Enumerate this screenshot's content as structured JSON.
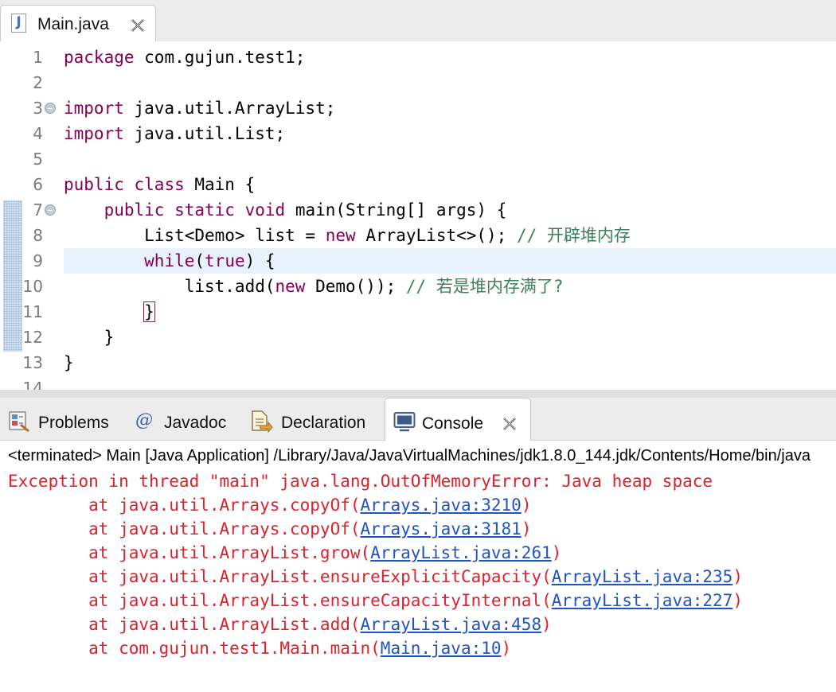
{
  "editor": {
    "tab_label": "Main.java",
    "lines": [
      {
        "num": "1",
        "parts": [
          {
            "t": "package",
            "c": "kw"
          },
          {
            "t": " com.gujun.test1;",
            "c": ""
          }
        ]
      },
      {
        "num": "2",
        "parts": []
      },
      {
        "num": "3",
        "fold": true,
        "parts": [
          {
            "t": "import",
            "c": "kw"
          },
          {
            "t": " java.util.ArrayList;",
            "c": ""
          }
        ]
      },
      {
        "num": "4",
        "parts": [
          {
            "t": "import",
            "c": "kw"
          },
          {
            "t": " java.util.List;",
            "c": ""
          }
        ]
      },
      {
        "num": "5",
        "parts": []
      },
      {
        "num": "6",
        "parts": [
          {
            "t": "public",
            "c": "kw"
          },
          {
            "t": " ",
            "c": ""
          },
          {
            "t": "class",
            "c": "kw"
          },
          {
            "t": " Main {",
            "c": ""
          }
        ]
      },
      {
        "num": "7",
        "fold": true,
        "parts": [
          {
            "t": "    ",
            "c": ""
          },
          {
            "t": "public",
            "c": "kw"
          },
          {
            "t": " ",
            "c": ""
          },
          {
            "t": "static",
            "c": "kw"
          },
          {
            "t": " ",
            "c": ""
          },
          {
            "t": "void",
            "c": "kw"
          },
          {
            "t": " main(String[] args) {",
            "c": ""
          }
        ]
      },
      {
        "num": "8",
        "parts": [
          {
            "t": "        List<Demo> list = ",
            "c": ""
          },
          {
            "t": "new",
            "c": "kw"
          },
          {
            "t": " ArrayList<>(); ",
            "c": ""
          },
          {
            "t": "// 开辟堆内存",
            "c": "cm"
          }
        ]
      },
      {
        "num": "9",
        "current": true,
        "parts": [
          {
            "t": "        ",
            "c": ""
          },
          {
            "t": "while",
            "c": "kw"
          },
          {
            "t": "(",
            "c": ""
          },
          {
            "t": "true",
            "c": "kw"
          },
          {
            "t": ") {",
            "c": ""
          }
        ]
      },
      {
        "num": "10",
        "parts": [
          {
            "t": "            list.add(",
            "c": ""
          },
          {
            "t": "new",
            "c": "kw"
          },
          {
            "t": " Demo()); ",
            "c": ""
          },
          {
            "t": "// 若是堆内存满了?",
            "c": "cm"
          }
        ]
      },
      {
        "num": "11",
        "parts": [
          {
            "t": "        ",
            "c": ""
          },
          {
            "t": "}",
            "c": "brace-box"
          }
        ]
      },
      {
        "num": "12",
        "parts": [
          {
            "t": "    }",
            "c": ""
          }
        ]
      },
      {
        "num": "13",
        "parts": [
          {
            "t": "}",
            "c": ""
          }
        ]
      },
      {
        "num": "14",
        "parts": []
      }
    ]
  },
  "views": {
    "tabs": [
      {
        "label": "Problems",
        "icon": "problems-icon"
      },
      {
        "label": "Javadoc",
        "icon": "javadoc-icon"
      },
      {
        "label": "Declaration",
        "icon": "declaration-icon"
      },
      {
        "label": "Console",
        "icon": "console-icon",
        "active": true
      }
    ]
  },
  "console": {
    "header": "<terminated> Main [Java Application] /Library/Java/JavaVirtualMachines/jdk1.8.0_144.jdk/Contents/Home/bin/java",
    "exception": "Exception in thread \"main\" java.lang.OutOfMemoryError: Java heap space",
    "frames": [
      {
        "prefix": "        at java.util.Arrays.copyOf(",
        "link": "Arrays.java:3210"
      },
      {
        "prefix": "        at java.util.Arrays.copyOf(",
        "link": "Arrays.java:3181"
      },
      {
        "prefix": "        at java.util.ArrayList.grow(",
        "link": "ArrayList.java:261"
      },
      {
        "prefix": "        at java.util.ArrayList.ensureExplicitCapacity(",
        "link": "ArrayList.java:235"
      },
      {
        "prefix": "        at java.util.ArrayList.ensureCapacityInternal(",
        "link": "ArrayList.java:227"
      },
      {
        "prefix": "        at java.util.ArrayList.add(",
        "link": "ArrayList.java:458"
      },
      {
        "prefix": "        at com.gujun.test1.Main.main(",
        "link": "Main.java:10"
      }
    ],
    "frame_suffix": ")"
  }
}
